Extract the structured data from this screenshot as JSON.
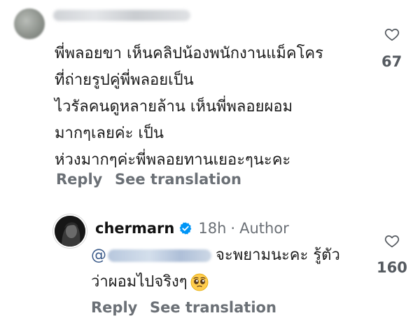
{
  "comment": {
    "lines": [
      "พี่พลอยขา เห็นคลิปน้องพนักงานแม็คโคร",
      "ที่ถ่ายรูปคู่พี่พลอยเป็น",
      "ไวรัลคนดูหลายล้าน เห็นพี่พลอยผอม",
      "มากๆเลยค่ะ เป็น",
      "ห่วงมากๆค่ะพี่พลอยทานเยอะๆนะคะ"
    ],
    "likes": "67",
    "reply_label": "Reply",
    "translate_label": "See translation"
  },
  "reply": {
    "username": "chermarn",
    "time": "18h",
    "separator": "·",
    "role": "Author",
    "mention_prefix": "@",
    "line1_text": "จะพยามนะคะ รู้ตัว",
    "line2_text": "ว่าผอมไปจริงๆ",
    "likes": "160",
    "reply_label": "Reply",
    "translate_label": "See translation"
  },
  "colors": {
    "verified": "#0095f6",
    "secondary_text": "#6b7076"
  },
  "icons": {
    "like": "heart-outline-icon",
    "verified": "verified-badge-icon",
    "emoji": "pleading-face-emoji"
  }
}
